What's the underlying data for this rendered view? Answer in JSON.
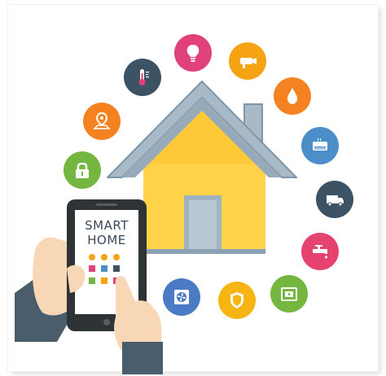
{
  "phone": {
    "line1": "SMART",
    "line2": "HOME"
  },
  "colors": {
    "house_roof": "#a9b9c6",
    "house_body": "#ffd24a",
    "house_outline": "#7c97ab",
    "phone_body": "#2e3336",
    "screen": "#ffffff",
    "sleeve": "#4a5d6c",
    "skin": "#f7d7b5"
  },
  "icons": [
    {
      "name": "lightbulb-icon",
      "color": "#e0417a"
    },
    {
      "name": "security-camera-icon",
      "color": "#f6a313"
    },
    {
      "name": "water-drop-icon",
      "color": "#f58220"
    },
    {
      "name": "air-conditioner-icon",
      "color": "#4b8ec8"
    },
    {
      "name": "delivery-truck-icon",
      "color": "#3b5364"
    },
    {
      "name": "water-tap-icon",
      "color": "#e6426f"
    },
    {
      "name": "safe-box-icon",
      "color": "#74b640"
    },
    {
      "name": "shield-icon",
      "color": "#f7b514"
    },
    {
      "name": "fan-icon",
      "color": "#4b7bc4"
    },
    {
      "name": "padlock-icon",
      "color": "#74b640"
    },
    {
      "name": "map-pin-icon",
      "color": "#f58220"
    },
    {
      "name": "thermometer-icon",
      "color": "#3b5364"
    }
  ]
}
